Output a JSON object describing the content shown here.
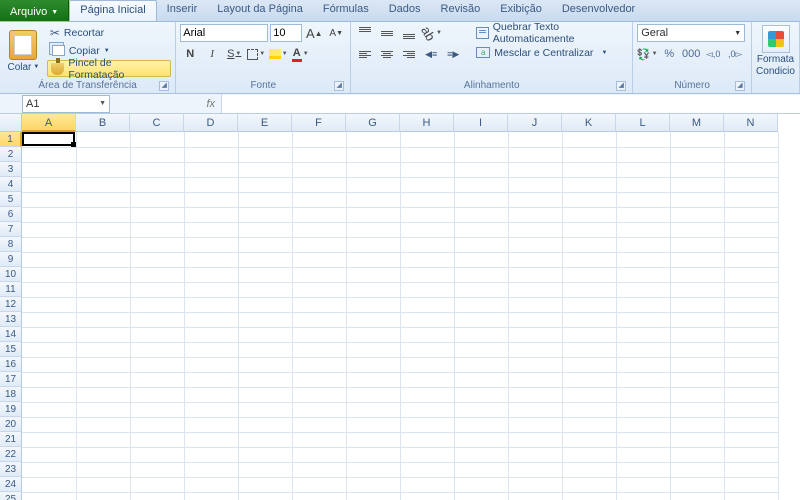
{
  "tabs": {
    "file": "Arquivo",
    "items": [
      "Página Inicial",
      "Inserir",
      "Layout da Página",
      "Fórmulas",
      "Dados",
      "Revisão",
      "Exibição",
      "Desenvolvedor"
    ],
    "active_index": 0
  },
  "ribbon": {
    "clipboard": {
      "paste": "Colar",
      "cut": "Recortar",
      "copy": "Copiar",
      "format_painter": "Pincel de Formatação",
      "group_label": "Área de Transferência"
    },
    "font": {
      "font_name": "Arial",
      "font_size": "10",
      "grow": "A",
      "shrink": "A",
      "bold": "N",
      "italic": "I",
      "underline": "S",
      "strike": "S",
      "font_color_letter": "A",
      "group_label": "Fonte"
    },
    "alignment": {
      "wrap": "Quebrar Texto Automaticamente",
      "merge": "Mesclar e Centralizar",
      "group_label": "Alinhamento"
    },
    "number": {
      "format": "Geral",
      "percent": "%",
      "comma": "000",
      "inc_dec_labels": [
        ",0",
        ",00"
      ],
      "group_label": "Número"
    },
    "styles": {
      "cf_line1": "Formata",
      "cf_line2": "Condicio"
    }
  },
  "formula_bar": {
    "name_box": "A1",
    "fx": "fx",
    "formula": ""
  },
  "grid": {
    "columns": [
      "A",
      "B",
      "C",
      "D",
      "E",
      "F",
      "G",
      "H",
      "I",
      "J",
      "K",
      "L",
      "M",
      "N"
    ],
    "rows": [
      1,
      2,
      3,
      4,
      5,
      6,
      7,
      8,
      9,
      10,
      11,
      12,
      13,
      14,
      15,
      16,
      17,
      18,
      19,
      20,
      21,
      22,
      23,
      24,
      25
    ],
    "selected_cell": "A1"
  }
}
